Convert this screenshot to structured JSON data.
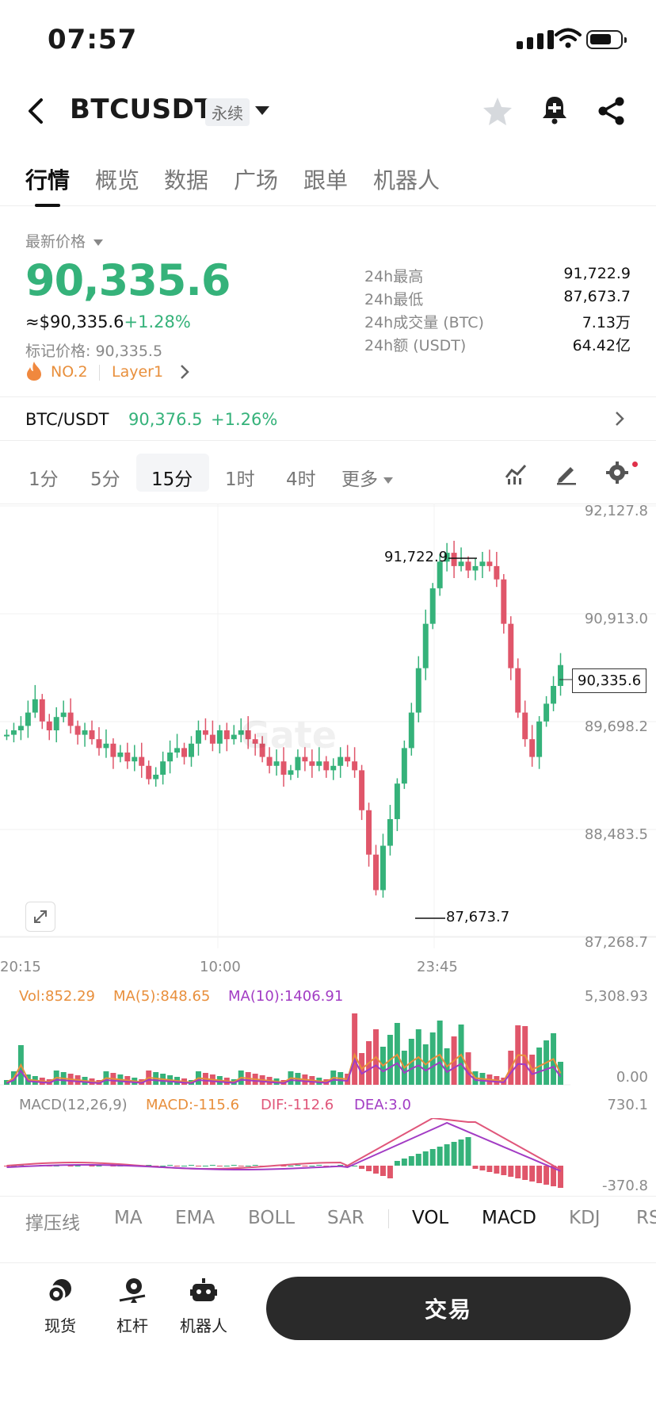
{
  "status": {
    "time": "07:57"
  },
  "header": {
    "title": "BTCUSDT",
    "tag": "永续"
  },
  "tabs": [
    "行情",
    "概览",
    "数据",
    "广场",
    "跟单",
    "机器人"
  ],
  "market": {
    "latest_label": "最新价格",
    "price": "90,335.6",
    "usd_price": "≈$90,335.6",
    "change": "+1.28%",
    "mark_price": "标记价格: 90,335.5",
    "rank": "NO.2",
    "category": "Layer1",
    "stats": [
      {
        "label": "24h最高",
        "value": "91,722.9"
      },
      {
        "label": "24h最低",
        "value": "87,673.7"
      },
      {
        "label": "24h成交量 (BTC)",
        "value": "7.13万"
      },
      {
        "label": "24h额 (USDT)",
        "value": "64.42亿"
      }
    ]
  },
  "spot": {
    "pair": "BTC/USDT",
    "price": "90,376.5",
    "change": "+1.26%"
  },
  "timeframes": [
    "1分",
    "5分",
    "15分",
    "1时",
    "4时",
    "更多"
  ],
  "chart": {
    "y_ticks": [
      "92,127.8",
      "90,913.0",
      "89,698.2",
      "88,483.5",
      "87,268.7"
    ],
    "x_ticks": [
      "20:15",
      "10:00",
      "23:45"
    ],
    "high_label": "91,722.9",
    "low_label": "87,673.7",
    "current_label": "90,335.6",
    "watermark": "Gate"
  },
  "volume": {
    "vol": "Vol:852.29",
    "ma5": "MA(5):848.65",
    "ma10": "MA(10):1406.91",
    "top": "5,308.93",
    "bottom": "0.00"
  },
  "macd": {
    "name": "MACD(12,26,9)",
    "macd": "MACD:-115.6",
    "dif": "DIF:-112.6",
    "dea": "DEA:3.0",
    "top": "730.1",
    "bottom": "-370.8"
  },
  "indicators": [
    "撑压线",
    "MA",
    "EMA",
    "BOLL",
    "SAR",
    "VOL",
    "MACD",
    "KDJ",
    "RS"
  ],
  "bottom_nav": [
    "现货",
    "杠杆",
    "机器人"
  ],
  "trade_button": "交易",
  "colors": {
    "up": "#35b27a",
    "down": "#e0566a",
    "accent": "#e88f3c",
    "purple": "#a23cc4"
  }
}
